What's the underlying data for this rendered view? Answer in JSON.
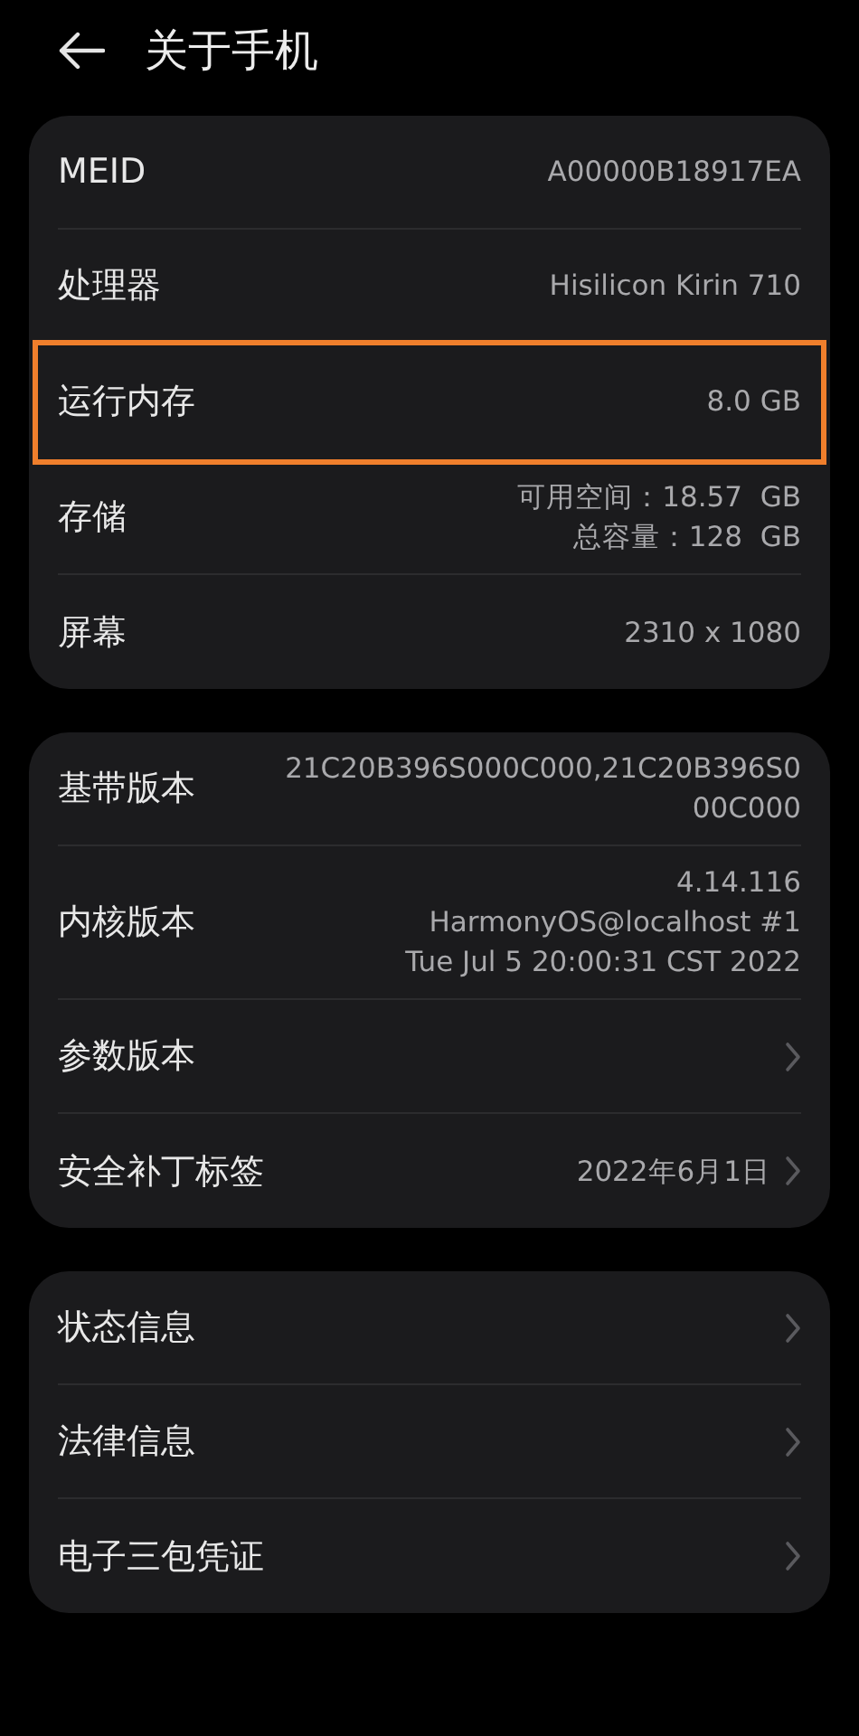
{
  "header": {
    "title": "关于手机"
  },
  "groups": [
    {
      "rows": [
        {
          "label": "MEID",
          "value_lines": [
            "A00000B18917EA"
          ],
          "chevron": false,
          "highlighted": false
        },
        {
          "label": "处理器",
          "value_lines": [
            "Hisilicon Kirin 710"
          ],
          "chevron": false,
          "highlighted": false
        },
        {
          "label": "运行内存",
          "value_lines": [
            "8.0 GB"
          ],
          "chevron": false,
          "highlighted": true
        },
        {
          "label": "存储",
          "value_lines": [
            "可用空间：18.57  GB",
            "总容量：128  GB"
          ],
          "chevron": false,
          "highlighted": false
        },
        {
          "label": "屏幕",
          "value_lines": [
            "2310 x 1080"
          ],
          "chevron": false,
          "highlighted": false
        }
      ]
    },
    {
      "rows": [
        {
          "label": "基带版本",
          "value_lines": [
            "21C20B396S000C000,21C20B396S0",
            "00C000"
          ],
          "chevron": false,
          "highlighted": false
        },
        {
          "label": "内核版本",
          "value_lines": [
            "4.14.116",
            "HarmonyOS@localhost #1",
            "Tue Jul 5 20:00:31 CST 2022"
          ],
          "chevron": false,
          "highlighted": false
        },
        {
          "label": "参数版本",
          "value_lines": [],
          "chevron": true,
          "highlighted": false
        },
        {
          "label": "安全补丁标签",
          "value_lines": [
            "2022年6月1日"
          ],
          "chevron": true,
          "highlighted": false
        }
      ]
    },
    {
      "rows": [
        {
          "label": "状态信息",
          "value_lines": [],
          "chevron": true,
          "highlighted": false
        },
        {
          "label": "法律信息",
          "value_lines": [],
          "chevron": true,
          "highlighted": false
        },
        {
          "label": "电子三包凭证",
          "value_lines": [],
          "chevron": true,
          "highlighted": false
        }
      ]
    }
  ]
}
